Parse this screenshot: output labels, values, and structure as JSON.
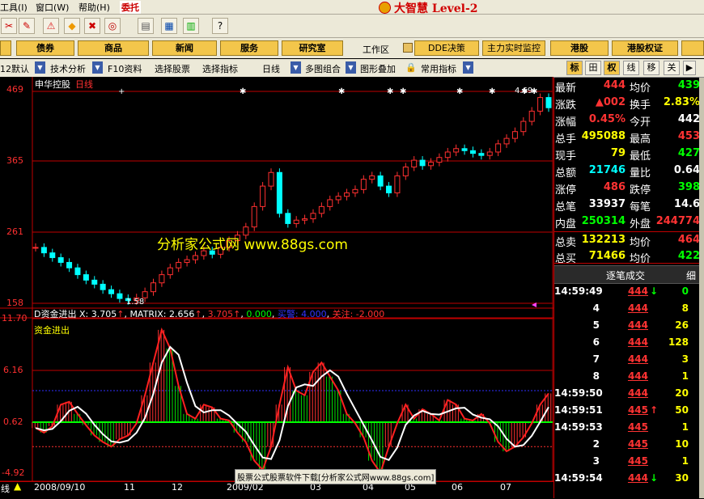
{
  "menubar": {
    "items": [
      "工具(I)",
      "窗口(W)",
      "帮助(H)"
    ],
    "entrust": "委托",
    "brand": "大智慧 Level-2"
  },
  "navbar": {
    "buttons": [
      "债券",
      "商品",
      "新闻",
      "服务",
      "研究室"
    ],
    "workarea": "工作区",
    "right_buttons": [
      "DDE决策",
      "主力实时监控",
      "港股",
      "港股权证"
    ]
  },
  "tabbar": {
    "items": [
      "12默认",
      "技术分析",
      "F10资料",
      "选择股票",
      "选择指标",
      "日线",
      "多图组合",
      "图形叠加",
      "常用指标"
    ],
    "right": [
      "标",
      "田",
      "权",
      "线",
      "移",
      "关"
    ]
  },
  "chart": {
    "title": "申华控股",
    "period": "日线",
    "price_ticks": [
      "469",
      "365",
      "261",
      "158"
    ],
    "max_label": "4.69",
    "min_label": "1.58",
    "indicator_line": {
      "name": "D资金进出",
      "x_label": "X: 3.705",
      "matrix_label": "MATRIX: 2.656",
      "v3": "3.705",
      "v4": "0.000",
      "buy_label": "买警: 4.000",
      "watch_label": "关注: -2.000"
    },
    "sub_title": "资金进出",
    "ind_ticks": [
      "11.70",
      "6.16",
      "0.62",
      "-4.92"
    ],
    "date_labels": [
      "2008/09/10",
      "11",
      "12",
      "2009/02",
      "03",
      "04",
      "05",
      "06",
      "07"
    ],
    "watermark": "分析家公式网 www.88gs.com",
    "footer_note": "股票公式股票软件下载[分析家公式网www.88gs.com]",
    "corner": "线"
  },
  "chart_data": {
    "type": "line",
    "price_ylim": [
      158,
      469
    ],
    "price_close": [
      240,
      232,
      225,
      218,
      210,
      200,
      192,
      186,
      178,
      172,
      165,
      162,
      166,
      175,
      188,
      200,
      210,
      218,
      222,
      228,
      235,
      230,
      240,
      250,
      258,
      270,
      300,
      330,
      350,
      290,
      275,
      280,
      282,
      290,
      300,
      310,
      315,
      320,
      325,
      340,
      345,
      330,
      320,
      345,
      358,
      368,
      360,
      365,
      372,
      380,
      385,
      382,
      378,
      375,
      380,
      392,
      400,
      410,
      425,
      440,
      460,
      445
    ],
    "ind_ylim": [
      -4.92,
      11.7
    ],
    "x_line": [
      0,
      -0.5,
      0.2,
      2.5,
      2.8,
      1.5,
      0.3,
      -0.8,
      -1.5,
      -2,
      -1.2,
      -0.8,
      0.5,
      3.5,
      7,
      10.5,
      8.5,
      4.5,
      1.5,
      1,
      2.5,
      2.2,
      1,
      0.8,
      -0.5,
      -1.5,
      -3.5,
      -4.5,
      -2,
      2.5,
      6.5,
      4,
      3.5,
      6,
      7,
      5.5,
      4,
      1.5,
      0.5,
      -1,
      -3.5,
      -4.8,
      -2,
      0.5,
      2.5,
      1,
      2,
      1.5,
      0.8,
      3,
      2.5,
      1,
      0.8,
      1.5,
      0.5,
      -1.5,
      -2.5,
      -2,
      -1,
      0.5,
      2.5,
      3.7
    ],
    "buy_level": 4,
    "watch_level": -2
  },
  "quote": {
    "rows": [
      {
        "l1": "最新",
        "v1": "444",
        "c1": "#ff3333",
        "l2": "均价",
        "v2": "439",
        "c2": "#00ff00"
      },
      {
        "l1": "涨跌",
        "v1": "▲002",
        "c1": "#ff3333",
        "l2": "换手",
        "v2": "2.83%",
        "c2": "#ffff00"
      },
      {
        "l1": "涨幅",
        "v1": "0.45%",
        "c1": "#ff3333",
        "l2": "今开",
        "v2": "442",
        "c2": "#ffffff"
      },
      {
        "l1": "总手",
        "v1": "495088",
        "c1": "#ffff00",
        "l2": "最高",
        "v2": "453",
        "c2": "#ff3333"
      },
      {
        "l1": "现手",
        "v1": "79",
        "c1": "#ffff00",
        "l2": "最低",
        "v2": "427",
        "c2": "#00ff00"
      },
      {
        "l1": "总额",
        "v1": "21746",
        "c1": "#00ffff",
        "l2": "量比",
        "v2": "0.64",
        "c2": "#ffffff"
      },
      {
        "l1": "涨停",
        "v1": "486",
        "c1": "#ff3333",
        "l2": "跌停",
        "v2": "398",
        "c2": "#00ff00"
      },
      {
        "l1": "总笔",
        "v1": "33937",
        "c1": "#ffffff",
        "l2": "每笔",
        "v2": "14.6",
        "c2": "#ffffff"
      },
      {
        "l1": "内盘",
        "v1": "250314",
        "c1": "#00ff00",
        "l2": "外盘",
        "v2": "244774",
        "c2": "#ff3333"
      }
    ],
    "sell": {
      "l1": "总卖",
      "v1": "132213",
      "l2": "均价",
      "v2": "464"
    },
    "buy": {
      "l1": "总买",
      "v1": "71466",
      "l2": "均价",
      "v2": "422"
    }
  },
  "trades": {
    "header": "逐笔成交",
    "detail": "细",
    "rows": [
      {
        "t": "14:59:49",
        "p": "444",
        "a": "↓",
        "ac": "#00ff00",
        "v": "0",
        "vc": "#00ff00"
      },
      {
        "t": "4",
        "p": "444",
        "a": "",
        "ac": "",
        "v": "8",
        "vc": "#ffff00"
      },
      {
        "t": "5",
        "p": "444",
        "a": "",
        "ac": "",
        "v": "26",
        "vc": "#ffff00"
      },
      {
        "t": "6",
        "p": "444",
        "a": "",
        "ac": "",
        "v": "128",
        "vc": "#ffff00"
      },
      {
        "t": "7",
        "p": "444",
        "a": "",
        "ac": "",
        "v": "3",
        "vc": "#ffff00"
      },
      {
        "t": "8",
        "p": "444",
        "a": "",
        "ac": "",
        "v": "1",
        "vc": "#ffff00"
      },
      {
        "t": "14:59:50",
        "p": "444",
        "a": "",
        "ac": "",
        "v": "20",
        "vc": "#ffff00"
      },
      {
        "t": "14:59:51",
        "p": "445",
        "a": "↑",
        "ac": "#ff3333",
        "v": "50",
        "vc": "#ffff00"
      },
      {
        "t": "14:59:53",
        "p": "445",
        "a": "",
        "ac": "",
        "v": "1",
        "vc": "#ffff00"
      },
      {
        "t": "2",
        "p": "445",
        "a": "",
        "ac": "",
        "v": "10",
        "vc": "#ffff00"
      },
      {
        "t": "3",
        "p": "445",
        "a": "",
        "ac": "",
        "v": "1",
        "vc": "#ffff00"
      },
      {
        "t": "14:59:54",
        "p": "444",
        "a": "↓",
        "ac": "#00ff00",
        "v": "30",
        "vc": "#ffff00"
      }
    ]
  }
}
